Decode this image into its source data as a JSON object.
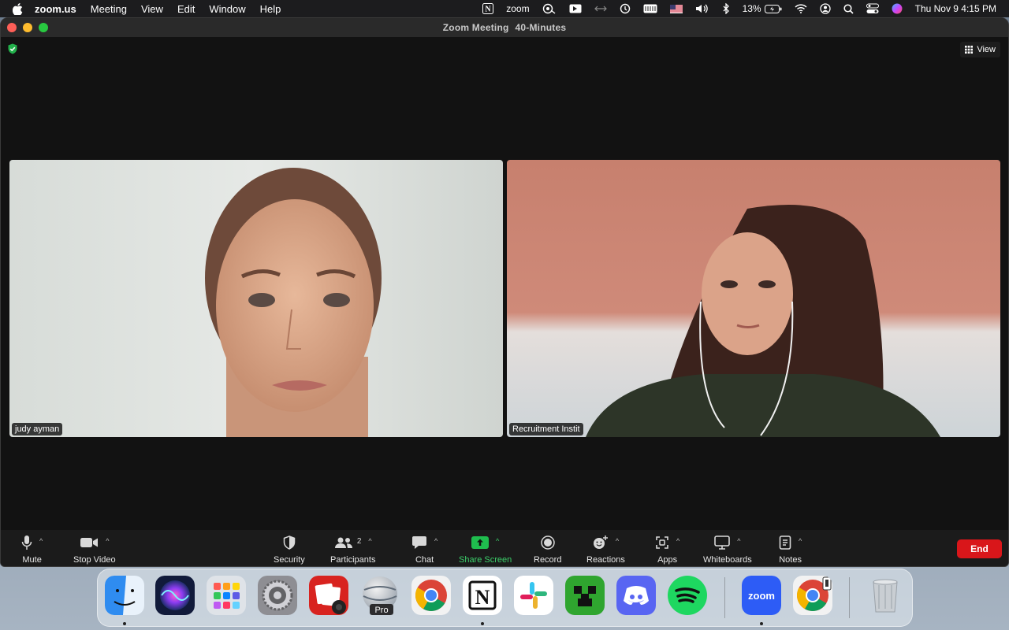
{
  "menubar": {
    "app": "zoom.us",
    "items": [
      "Meeting",
      "View",
      "Edit",
      "Window",
      "Help"
    ],
    "zoom_status": "zoom",
    "battery": "13%",
    "datetime": "Thu Nov 9  4:15 PM"
  },
  "window": {
    "title": "Zoom Meeting",
    "subtitle": "40-Minutes",
    "view_label": "View"
  },
  "participants": [
    {
      "name": "judy ayman"
    },
    {
      "name": "Recruitment Instit"
    }
  ],
  "toolbar": {
    "mute": "Mute",
    "stop_video": "Stop Video",
    "security": "Security",
    "participants": "Participants",
    "participants_count": "2",
    "chat": "Chat",
    "share_screen": "Share Screen",
    "record": "Record",
    "reactions": "Reactions",
    "apps": "Apps",
    "whiteboards": "Whiteboards",
    "notes": "Notes",
    "end": "End"
  },
  "dock": {
    "pro_label": "Pro",
    "zoom_label": "zoom",
    "apps": [
      "finder-icon",
      "siri-icon",
      "launchpad-icon",
      "system-settings-icon",
      "photo-booth-icon",
      "google-earth-pro-icon",
      "chrome-icon",
      "notion-icon",
      "slack-icon",
      "minecraft-icon",
      "discord-icon",
      "spotify-icon",
      "zoom-icon",
      "chrome-app-icon",
      "trash-icon"
    ]
  },
  "colors": {
    "share_green": "#3ccf6a",
    "end_red": "#d9161a",
    "toolbar_bg": "#1b1b1b",
    "tile2_bg": "#c97b69"
  }
}
